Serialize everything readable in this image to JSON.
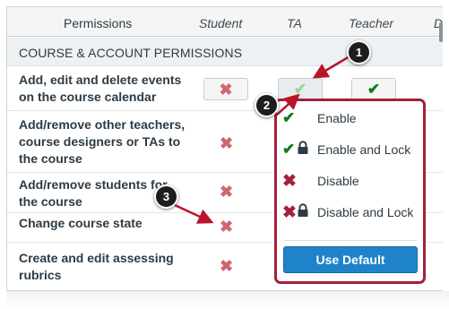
{
  "header": {
    "permissions": "Permissions",
    "student": "Student",
    "ta": "TA",
    "teacher": "Teacher",
    "designer_partial": "D"
  },
  "section": {
    "title": "COURSE & ACCOUNT PERMISSIONS"
  },
  "rows": [
    {
      "label_line1": "Add, edit and delete events",
      "label_line2": "on the course calendar"
    },
    {
      "label_line1": "Add/remove other teachers,",
      "label_line2": "course designers or TAs to",
      "label_line3": "the course"
    },
    {
      "label_line1": "Add/remove students for",
      "label_line2": "the course"
    },
    {
      "label_line1": "Change course state"
    },
    {
      "label_line1": "Create and edit assessing",
      "label_line2": "rubrics"
    }
  ],
  "icons": {
    "check": "✔",
    "cross": "✖"
  },
  "menu": {
    "items": [
      {
        "label": "Enable",
        "icon": "check-icon"
      },
      {
        "label": "Enable and Lock",
        "icon": "check-lock-icon"
      },
      {
        "label": "Disable",
        "icon": "x-icon"
      },
      {
        "label": "Disable and Lock",
        "icon": "x-lock-icon"
      }
    ],
    "use_default": "Use Default"
  },
  "callouts": [
    "1",
    "2",
    "3"
  ],
  "colors": {
    "accent_red": "#a3203c",
    "enable_green": "#127a1b",
    "disable_red": "#d06670",
    "button_blue": "#1f83c9",
    "badge": "#1d1d1d"
  }
}
